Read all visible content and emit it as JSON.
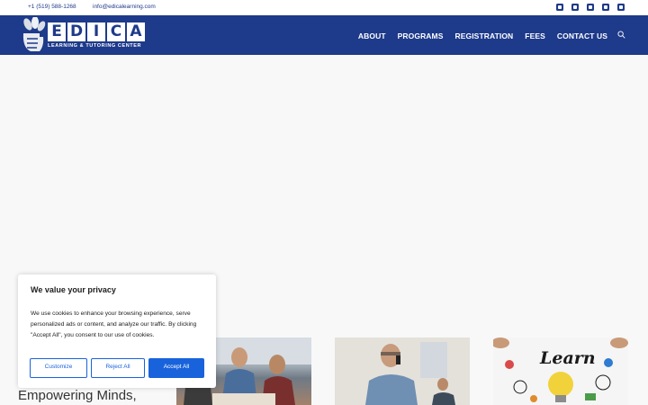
{
  "topbar": {
    "phone": "+1 (519) 588-1268",
    "email": "info@edicalearning.com",
    "social_icons": [
      "facebook-icon",
      "instagram-icon",
      "linkedin-icon",
      "twitter-icon",
      "youtube-icon"
    ]
  },
  "header": {
    "logo_letters": [
      "E",
      "D",
      "I",
      "C",
      "A"
    ],
    "logo_tagline": "LEARNING & TUTORING CENTER",
    "nav": [
      "ABOUT",
      "PROGRAMS",
      "REGISTRATION",
      "FEES",
      "CONTACT US"
    ]
  },
  "cookie": {
    "title": "We value your privacy",
    "body": "We use cookies to enhance your browsing experience, serve personalized ads or content, and analyze our traffic. By clicking \"Accept All\", you consent to our use of cookies.",
    "customize": "Customize",
    "reject": "Reject All",
    "accept": "Accept All"
  },
  "main": {
    "headline": "Empowering Minds,",
    "learn_image_text": "Learn"
  },
  "colors": {
    "brand": "#1e3a8a",
    "accent": "#1863dc",
    "background": "#f8f8f8"
  }
}
